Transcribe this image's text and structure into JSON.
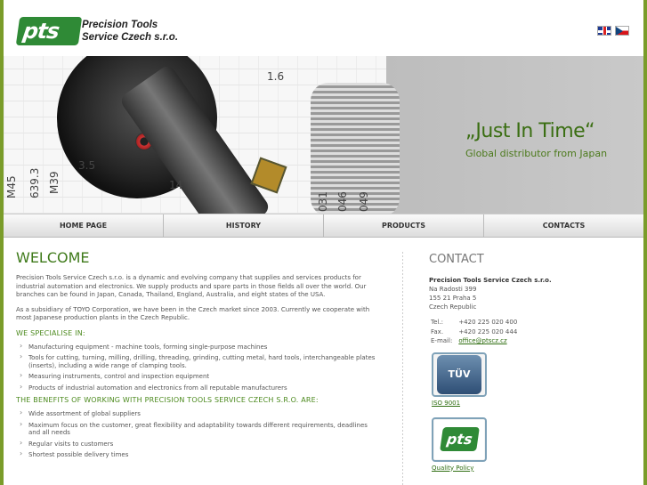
{
  "header": {
    "logo_text": "pts",
    "company_line1": "Precision Tools",
    "company_line2": "Service Czech s.r.o.",
    "flags": [
      "english-flag-icon",
      "czech-flag-icon"
    ]
  },
  "banner": {
    "slogan": "„Just In Time“",
    "subtitle": "Global distributor from Japan",
    "dims": [
      "1.6",
      "3.5",
      "14",
      "M39",
      "639.3",
      "M45",
      "031",
      "046",
      "049"
    ]
  },
  "nav": {
    "items": [
      "HOME PAGE",
      "HISTORY",
      "PRODUCTS",
      "CONTACTS"
    ]
  },
  "main": {
    "title": "WELCOME",
    "para1": "Precision Tools Service Czech s.r.o. is a dynamic and evolving company that supplies and services products for industrial automation and electronics. We supply products and spare parts in those fields all over the world. Our branches can be found in Japan, Canada, Thailand, England, Australia, and eight states of the USA.",
    "para2": "As a subsidiary of TOYO Corporation, we have been in the Czech market since 2003. Currently we cooperate with most Japanese production plants in the Czech Republic.",
    "specialise_heading": "WE SPECIALISE IN:",
    "specialise": [
      "Manufacturing equipment - machine tools, forming single-purpose machines",
      "Tools for cutting, turning, milling, drilling, threading, grinding, cutting metal, hard tools, interchangeable plates (inserts), including a wide range of clamping tools.",
      "Measuring instruments, control and inspection equipment",
      "Products of industrial automation and electronics from all reputable manufacturers"
    ],
    "benefits_heading": "THE BENEFITS OF WORKING WITH PRECISION TOOLS SERVICE CZECH S.R.O. ARE:",
    "benefits": [
      "Wide assortment of global suppliers",
      "Maximum focus on the customer, great flexibility and adaptability towards different requirements, deadlines and all needs",
      "Regular visits to customers",
      "Shortest possible delivery times"
    ]
  },
  "contact": {
    "title": "CONTACT",
    "company": "Precision Tools Service Czech s.r.o.",
    "street": "Na Radosti 399",
    "city": "155 21 Praha 5",
    "country": "Czech Republic",
    "tel_label": "Tel.:",
    "tel": "+420 225 020 400",
    "fax_label": "Fax.",
    "fax": "+420 225 020 444",
    "email_label": "E-mail:",
    "email": "office@ptscz.cz",
    "cert1_badge": "TÜV",
    "cert1_label": "ISO 9001",
    "cert2_badge": "pts",
    "cert2_label": "Quality Policy"
  }
}
